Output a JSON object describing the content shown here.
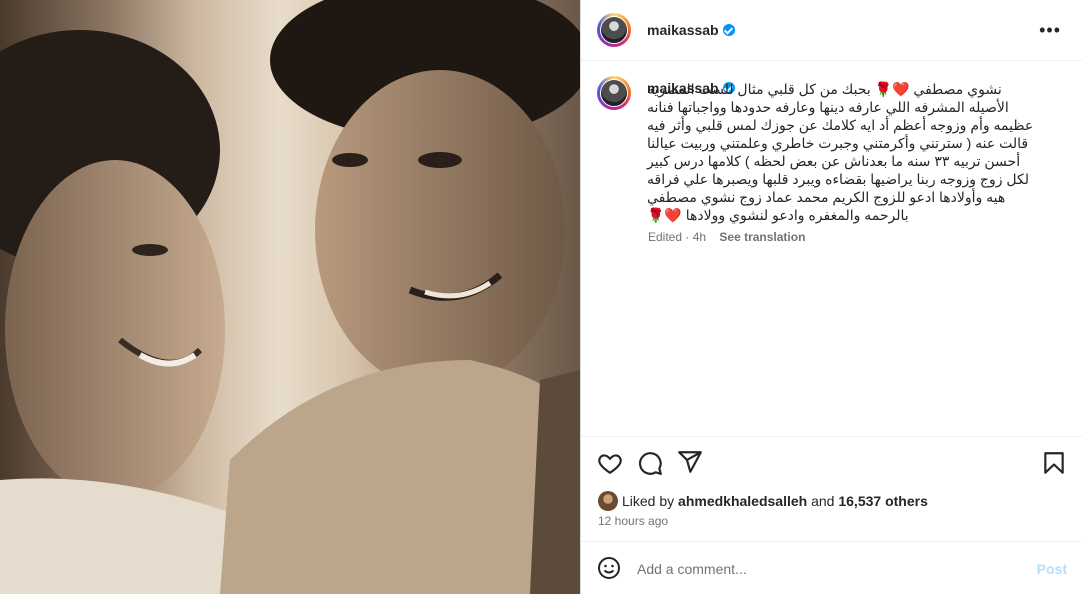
{
  "post": {
    "username": "maikassab",
    "caption_text": "نشوي مصطفي ❤️🌹 بحبك من كل قلبي مثال للست المصريه الأصيله المشرفه اللي عارفه دينها وعارفه حدودها وواجباتها فنانه عظيمه وأم وزوجه أعظم أد ايه كلامك عن جوزك لمس قلبي وأثر فيه قالت عنه ( سترتني وأكرمتني وجبرت خاطري وعلمتني وربيت عيالنا أحسن تربيه ٣٣ سنه ما بعدناش عن بعض لحظه ) كلامها درس كبير لكل زوج وزوجه ربنا يراضيها بقضاءه ويبرد قلبها ويصبرها علي فراقه هيه وأولادها ادعو للزوج الكريم محمد عماد زوج نشوي مصطفي بالرحمه والمغفره وادعو لنشوي وولادها ❤️🌹",
    "edited": "Edited · 4h",
    "see_translation": "See translation",
    "liked_by_prefix": "Liked by",
    "liked_by_user": "ahmedkhaledsalleh",
    "liked_by_and": "and",
    "others": "16,537 others",
    "posted_ago": "12 hours ago",
    "comment_placeholder": "Add a comment...",
    "post_label": "Post"
  },
  "icons": [
    "more-icon",
    "heart-icon",
    "comment-icon",
    "share-icon",
    "bookmark-icon",
    "emoji-icon",
    "verified-icon"
  ],
  "colors": {
    "verified": "#0095f6",
    "post_disabled": "#b2dffc",
    "muted": "#737373"
  }
}
